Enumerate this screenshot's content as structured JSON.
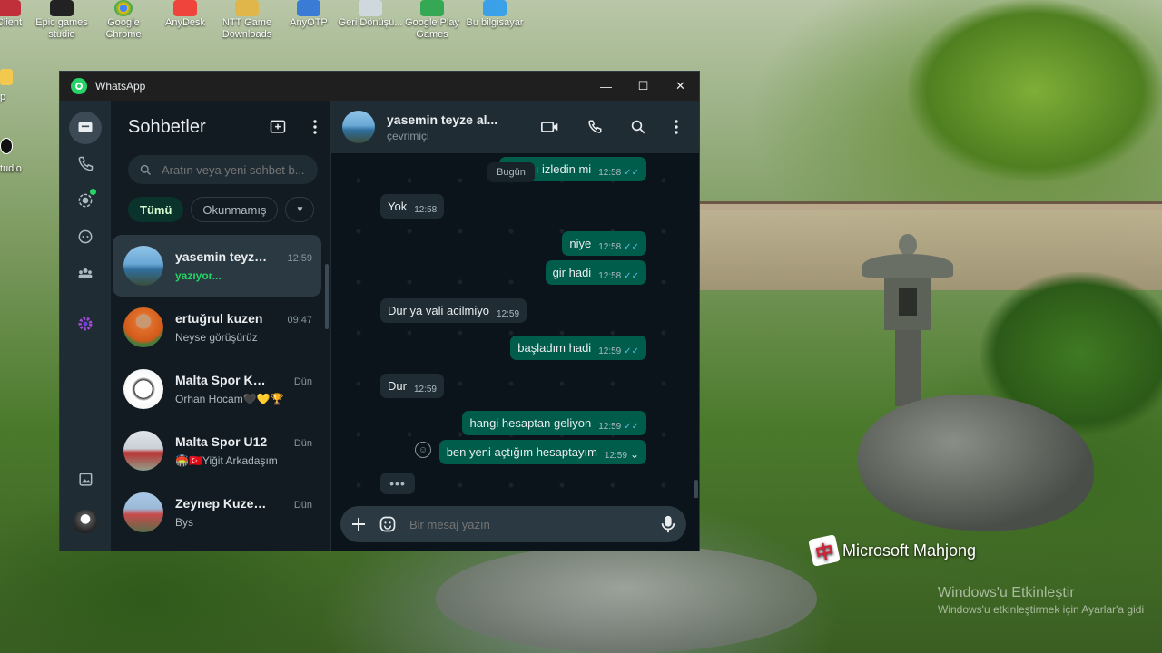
{
  "desktop": {
    "icons": [
      {
        "label": "Client",
        "icon": "app-icon"
      },
      {
        "label": "Epic games studio",
        "icon": "epic-games-icon"
      },
      {
        "label": "Google Chrome",
        "icon": "chrome-icon"
      },
      {
        "label": "AnyDesk",
        "icon": "anydesk-icon"
      },
      {
        "label": "NTT Game Downloads",
        "icon": "folder-icon"
      },
      {
        "label": "AnyOTP",
        "icon": "anyotp-icon"
      },
      {
        "label": "Geri Dönüşü...",
        "icon": "recycle-bin-icon"
      },
      {
        "label": "Google Play Games",
        "icon": "play-games-icon"
      },
      {
        "label": "Bu bilgisayar",
        "icon": "computer-icon"
      }
    ],
    "side_labels": [
      "p",
      "tudio"
    ],
    "mahjong_label": "Microsoft Mahjong",
    "activate_title": "Windows'u Etkinleştir",
    "activate_sub": "Windows'u etkinleştirmek için Ayarlar'a gidi"
  },
  "window": {
    "title": "WhatsApp",
    "minimize": "—",
    "maximize": "☐",
    "close": "✕"
  },
  "chats": {
    "title": "Sohbetler",
    "search_placeholder": "Aratın veya yeni sohbet b...",
    "filters": [
      "Tümü",
      "Okunmamış"
    ],
    "items": [
      {
        "name": "yasemin teyze...",
        "time": "12:59",
        "preview": "yazıyor...",
        "typing": true,
        "selected": true
      },
      {
        "name": "ertuğrul kuzen",
        "time": "09:47",
        "preview": "Neyse görüşürüz"
      },
      {
        "name": "Malta Spor Kul...",
        "time": "Dün",
        "preview": "Orhan Hocam🖤💛🏆"
      },
      {
        "name": "Malta Spor U12",
        "time": "Dün",
        "preview": "🏟️🇹🇷Yiğit Arkadaşım"
      },
      {
        "name": "Zeynep Kuzenim",
        "time": "Dün",
        "preview": "Bys"
      }
    ]
  },
  "conversation": {
    "name": "yasemin teyze al...",
    "status": "çevrimiçi",
    "day_badge": "Bugün",
    "messages": [
      {
        "dir": "out",
        "text": "can        nı izledin mi",
        "time": "12:58",
        "ticks": "✓✓"
      },
      {
        "dir": "in",
        "text": "Yok",
        "time": "12:58"
      },
      {
        "dir": "out",
        "text": "niye",
        "time": "12:58",
        "ticks": "✓✓"
      },
      {
        "dir": "out",
        "text": "gir hadi",
        "time": "12:58",
        "ticks": "✓✓"
      },
      {
        "dir": "in",
        "text": "Dur ya vali acilmiyo",
        "time": "12:59"
      },
      {
        "dir": "out",
        "text": "başladım hadi",
        "time": "12:59",
        "ticks": "✓✓"
      },
      {
        "dir": "in",
        "text": "Dur",
        "time": "12:59"
      },
      {
        "dir": "out",
        "text": "hangi hesaptan geliyon",
        "time": "12:59",
        "ticks": "✓✓"
      },
      {
        "dir": "out",
        "text": "ben yeni açtığım hesaptayım",
        "time": "12:59",
        "ticks": "⌄"
      }
    ],
    "typing_indicator": "•••",
    "composer_placeholder": "Bir mesaj yazın"
  },
  "colors": {
    "accent": "#25d366",
    "outgoing": "#005c4b",
    "incoming": "#202c33",
    "panel": "#111b21"
  }
}
